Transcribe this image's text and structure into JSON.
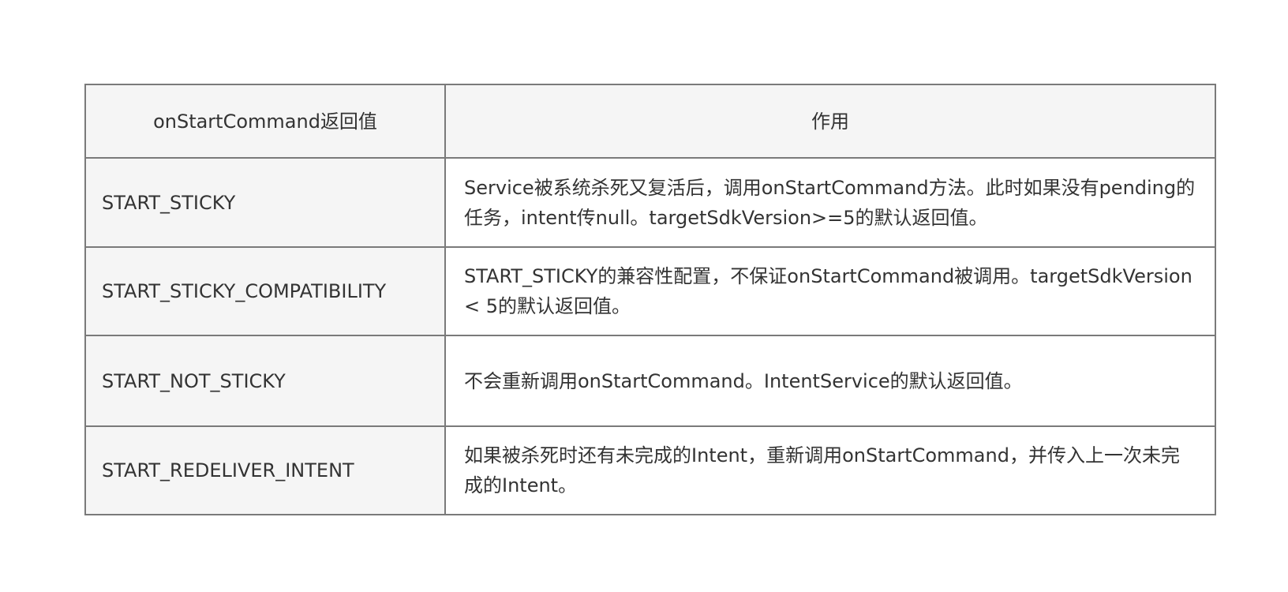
{
  "table": {
    "headers": {
      "return_value": "onStartCommand返回值",
      "purpose": "作用"
    },
    "rows": [
      {
        "name": "START_STICKY",
        "description": "Service被系统杀死又复活后，调用onStartCommand方法。此时如果没有pending的任务，intent传null。targetSdkVersion>=5的默认返回值。"
      },
      {
        "name": "START_STICKY_COMPATIBILITY",
        "description": "START_STICKY的兼容性配置，不保证onStartCommand被调用。targetSdkVersion < 5的默认返回值。"
      },
      {
        "name": "START_NOT_STICKY",
        "description": "不会重新调用onStartCommand。IntentService的默认返回值。"
      },
      {
        "name": "START_REDELIVER_INTENT",
        "description": "如果被杀死时还有未完成的Intent，重新调用onStartCommand，并传入上一次未完成的Intent。"
      }
    ]
  }
}
